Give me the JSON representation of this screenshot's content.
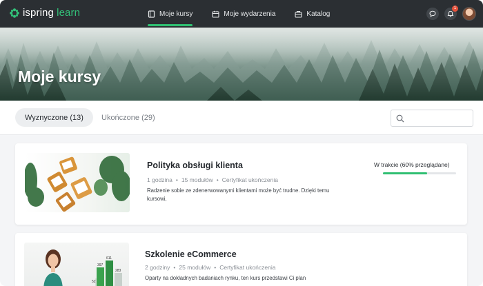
{
  "app": {
    "logo_brand": "ispring",
    "logo_product": " learn"
  },
  "nav": {
    "items": [
      {
        "label": "Moje kursy",
        "active": true,
        "icon": "book-icon"
      },
      {
        "label": "Moje wydarzenia",
        "active": false,
        "icon": "calendar-icon"
      },
      {
        "label": "Katalog",
        "active": false,
        "icon": "catalog-icon"
      }
    ],
    "notifications_count": "1"
  },
  "hero": {
    "title": "Moje kursy"
  },
  "tabs": [
    {
      "label": "Wyznyczone (13)",
      "active": true
    },
    {
      "label": "Ukończone (29)",
      "active": false
    }
  ],
  "search": {
    "placeholder": ""
  },
  "courses": [
    {
      "title": "Polityka obsługi klienta",
      "duration": "1 godzina",
      "modules": "15 modułów",
      "certificate": "Certyfikat ukończenia",
      "description": "Radzenie sobie ze zdenerwowanymi klientami może być trudne. Dzięki temu kursowi,",
      "status": "W trakcie (60% przeglądane)",
      "progress": 0.6
    },
    {
      "title": "Szkolenie eCommerce",
      "duration": "2 godziny",
      "modules": "25 modułów",
      "certificate": "Certyfikat ukończenia",
      "description": "Oparty na dokładnych badaniach rynku, ten kurs przedstawi Ci plan",
      "chart_labels": [
        "52",
        "397",
        "611",
        "283"
      ]
    }
  ],
  "colors": {
    "accent": "#2fbf71",
    "topbar": "#2b2f33"
  }
}
